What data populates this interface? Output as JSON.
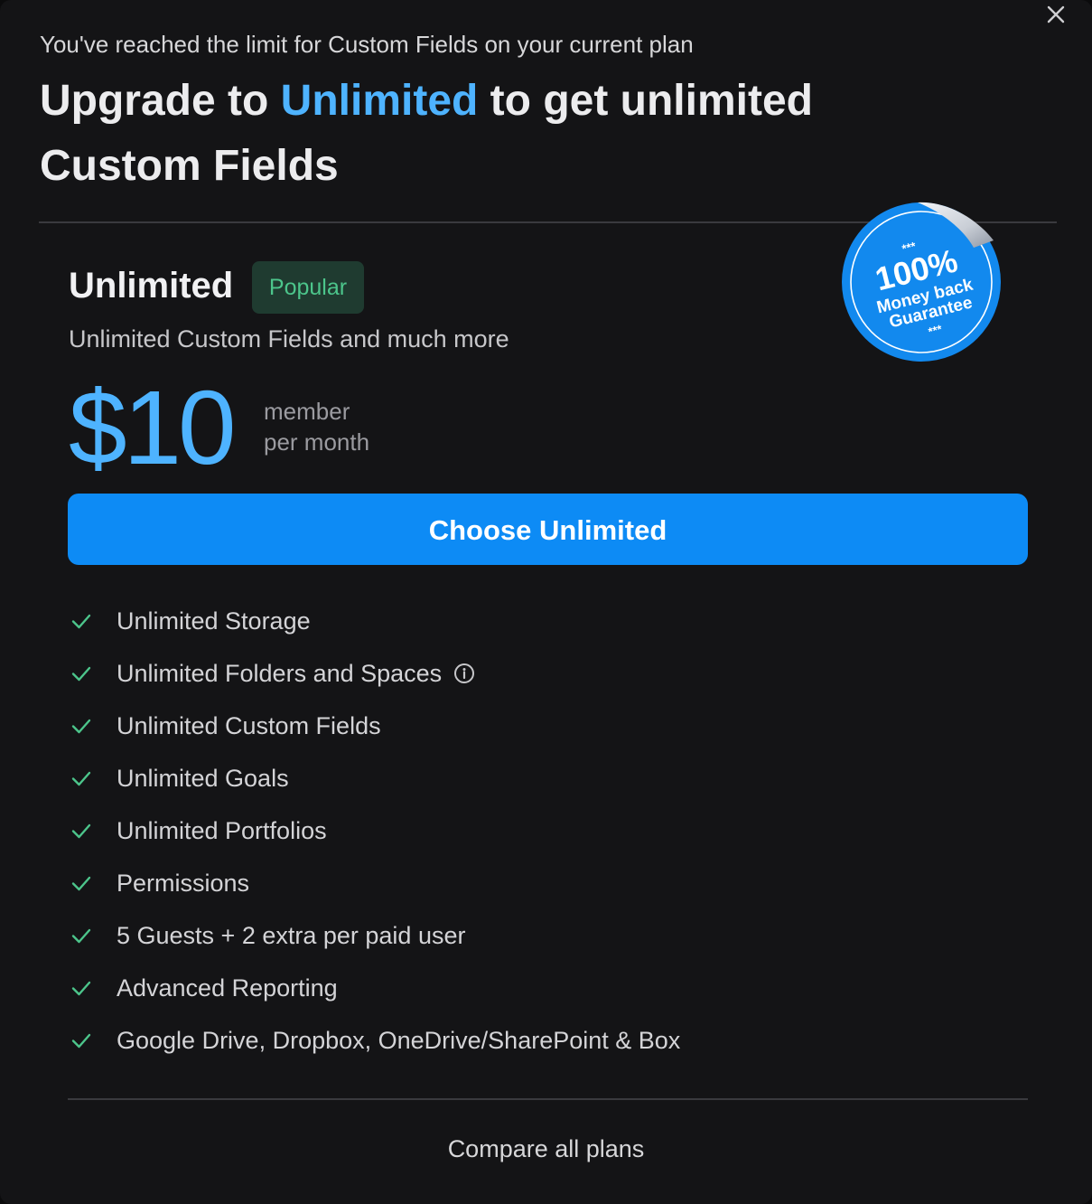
{
  "header": {
    "limit_message": "You've reached the limit for Custom Fields on your current plan",
    "headline_prefix": "Upgrade to ",
    "headline_plan": "Unlimited",
    "headline_suffix": " to get unlimited Custom Fields",
    "close_icon": "close-icon"
  },
  "plan": {
    "name": "Unlimited",
    "badge": "Popular",
    "description": "Unlimited Custom Fields and much more",
    "price": "$10",
    "price_unit_line1": "member",
    "price_unit_line2": "per month",
    "cta_label": "Choose Unlimited"
  },
  "sticker": {
    "stars_top": "***",
    "percent": "100%",
    "line1": "Money back",
    "line2": "Guarantee",
    "stars_bottom": "***"
  },
  "features": [
    {
      "label": "Unlimited Storage",
      "icon": "check-icon"
    },
    {
      "label": "Unlimited Folders and Spaces",
      "icon": "check-icon",
      "info_icon": "info-icon"
    },
    {
      "label": "Unlimited Custom Fields",
      "icon": "check-icon"
    },
    {
      "label": "Unlimited Goals",
      "icon": "check-icon"
    },
    {
      "label": "Unlimited Portfolios",
      "icon": "check-icon"
    },
    {
      "label": "Permissions",
      "icon": "check-icon"
    },
    {
      "label": "5 Guests + 2 extra per paid user",
      "icon": "check-icon"
    },
    {
      "label": "Advanced Reporting",
      "icon": "check-icon"
    },
    {
      "label": "Google Drive, Dropbox, OneDrive/SharePoint & Box",
      "icon": "check-icon"
    }
  ],
  "footer": {
    "compare_label": "Compare all plans"
  },
  "colors": {
    "background": "#141416",
    "accent": "#4eb3ff",
    "cta": "#0d8bf5",
    "check": "#4cc58b",
    "badge_bg": "#1f3b30",
    "badge_text": "#4cc58b",
    "sticker": "#1289ee"
  }
}
